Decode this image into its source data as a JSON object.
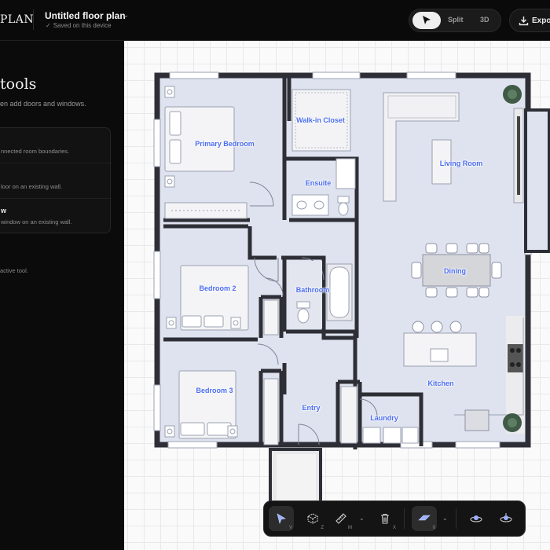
{
  "app": {
    "brand": "PLAN"
  },
  "document": {
    "title": "Untitled floor plan",
    "status": "Saved on this device"
  },
  "view_toggle": {
    "split_label": "Split",
    "three_d_label": "3D",
    "selected": "select-arrow-icon"
  },
  "export": {
    "label": "Expo"
  },
  "panel": {
    "title": "tools",
    "subtitle": "en add doors and windows.",
    "tools": [
      {
        "name": "",
        "desc": "nnected room boundaries."
      },
      {
        "name": "",
        "desc": "loor on an existing wall."
      },
      {
        "name": "w",
        "desc": "window on an existing wall."
      }
    ],
    "hint": "active tool."
  },
  "rooms": {
    "primary_bedroom": "Primary Bedroom",
    "walk_in_closet": "Walk-in Closet",
    "living_room": "Living Room",
    "ensuite": "Ensuite",
    "dining": "Dining",
    "bedroom_2": "Bedroom 2",
    "bathroom": "Bathroom",
    "kitchen": "Kitchen",
    "bedroom_3": "Bedroom 3",
    "entry": "Entry",
    "laundry": "Laundry"
  },
  "toolbar": {
    "select_key": "V",
    "room_key": "Z",
    "measure_key": "M",
    "delete_key": "X",
    "floor_key": "0",
    "icons": [
      "select-arrow-icon",
      "room-cube-icon",
      "measure-ruler-icon",
      "trash-icon",
      "floor-plane-icon",
      "camera-orbit-icon",
      "camera-top-icon"
    ]
  },
  "colors": {
    "accent": "#4a6cf0",
    "wall": "#2e2f36",
    "floor": "#dfe3ef",
    "background": "#0b0b0b"
  }
}
